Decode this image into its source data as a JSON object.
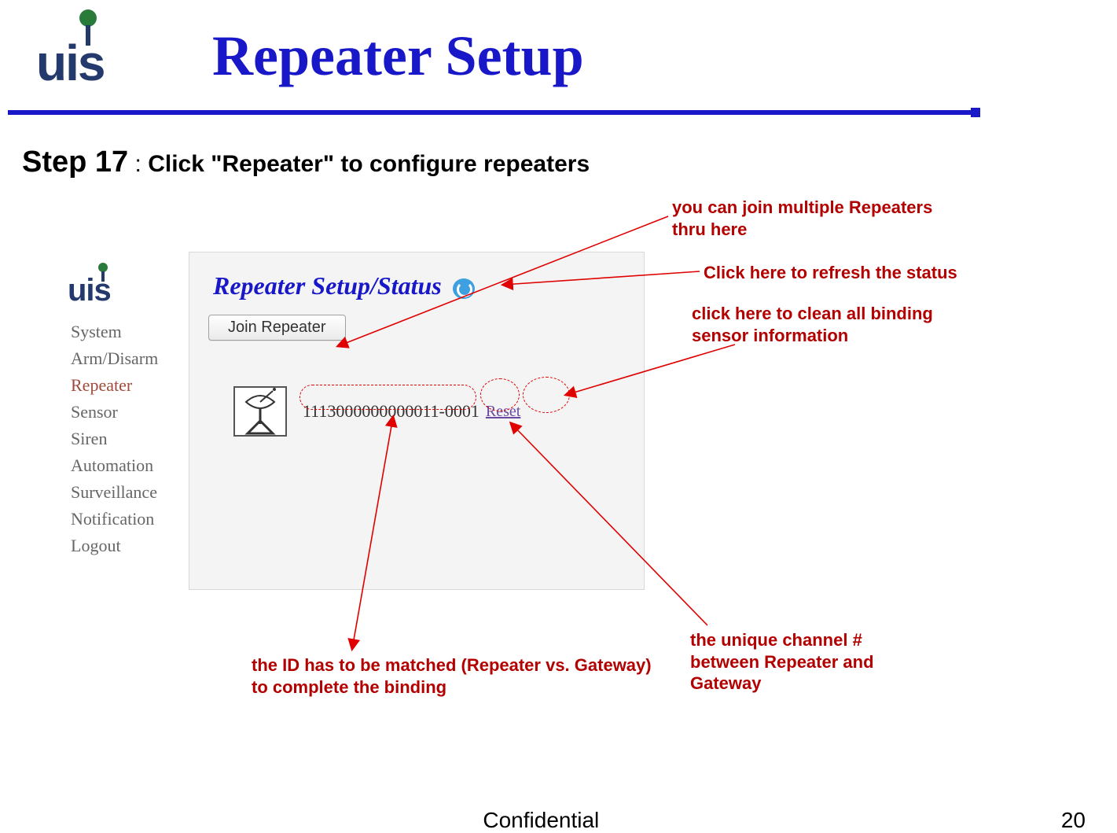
{
  "header": {
    "title": "Repeater Setup",
    "logo_text_small": "uis",
    "logo_text_panel": "uis"
  },
  "step": {
    "number": "Step 17",
    "separator": " : ",
    "instruction": "Click \"Repeater\" to configure repeaters"
  },
  "annotations": {
    "join_multiple": "you can join multiple Repeaters thru here",
    "refresh": "Click here to refresh the status",
    "clean": "click here to clean all binding sensor information",
    "channel": "the unique channel # between Repeater and Gateway",
    "id_match": "the ID has to be matched (Repeater vs. Gateway) to complete the binding"
  },
  "panel": {
    "heading": "Repeater Setup/Status",
    "join_button": "Join Repeater",
    "repeater_id": "1113000000000011-0001",
    "reset_label": "Reset"
  },
  "nav": {
    "items": [
      "System",
      "Arm/Disarm",
      "Repeater",
      "Sensor",
      "Siren",
      "Automation",
      "Surveillance",
      "Notification",
      "Logout"
    ],
    "active_index": 2
  },
  "footer": {
    "center": "Confidential",
    "page": "20"
  },
  "colors": {
    "title_blue": "#1818c8",
    "annot_red": "#b30000",
    "nav_gray": "#666666",
    "nav_active": "#a04a3a"
  }
}
